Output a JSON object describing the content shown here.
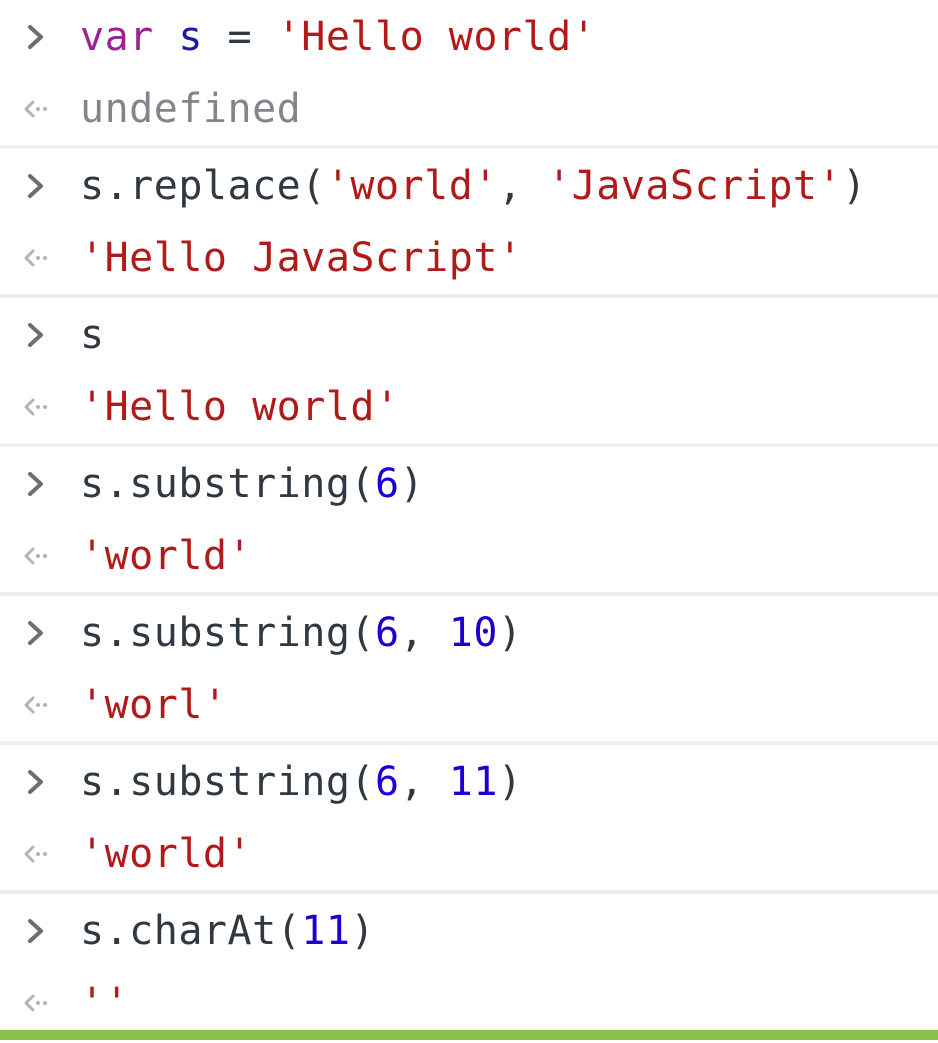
{
  "colors": {
    "keyword": "#9b2393",
    "variable": "#1a1aa6",
    "string": "#b21a1a",
    "number": "#1c00cf",
    "plain": "#303942",
    "undefined": "#80868b",
    "prompt_chevron": "#6e6e6e",
    "result_arrow": "#b0b4b8",
    "separator": "#eceef0",
    "status_bar": "#8cc14c"
  },
  "icons": {
    "input_prompt": "chevron-right-icon",
    "output_result": "arrow-left-icon"
  },
  "console": {
    "entries": [
      {
        "input": {
          "kw": "var",
          "sp1": " ",
          "var": "s",
          "eq": " = ",
          "str": "'Hello world'"
        },
        "output": {
          "undefined": "undefined"
        }
      },
      {
        "input": {
          "a": "s.replace(",
          "s1": "'world'",
          "comma": ", ",
          "s2": "'JavaScript'",
          "close": ")"
        },
        "output": {
          "str": "'Hello JavaScript'"
        }
      },
      {
        "input": {
          "a": "s"
        },
        "output": {
          "str": "'Hello world'"
        }
      },
      {
        "input": {
          "a": "s.substring(",
          "n1": "6",
          "close": ")"
        },
        "output": {
          "str": "'world'"
        }
      },
      {
        "input": {
          "a": "s.substring(",
          "n1": "6",
          "comma": ", ",
          "n2": "10",
          "close": ")"
        },
        "output": {
          "str": "'worl'"
        }
      },
      {
        "input": {
          "a": "s.substring(",
          "n1": "6",
          "comma": ", ",
          "n2": "11",
          "close": ")"
        },
        "output": {
          "str": "'world'"
        }
      },
      {
        "input": {
          "a": "s.charAt(",
          "n1": "11",
          "close": ")"
        },
        "output": {
          "str": "''"
        }
      }
    ]
  }
}
